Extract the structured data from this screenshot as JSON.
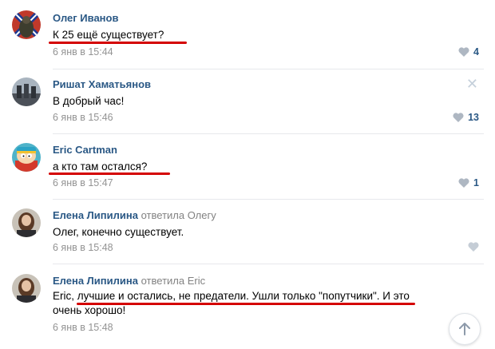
{
  "comments": [
    {
      "author": "Олег Иванов",
      "reply_to": "",
      "text": "К 25 ещё существует?",
      "date": "6 янв в 15:44",
      "likes": "4"
    },
    {
      "author": "Ришат Хаматьянов",
      "reply_to": "",
      "text": "В добрый час!",
      "date": "6 янв в 15:46",
      "likes": "13"
    },
    {
      "author": "Eric Cartman",
      "reply_to": "",
      "text": "а кто там остался?",
      "date": "6 янв в 15:47",
      "likes": "1"
    },
    {
      "author": "Елена Липилина",
      "reply_to": "ответила Олегу",
      "text": "Олег, конечно существует.",
      "date": "6 янв в 15:48",
      "likes": ""
    },
    {
      "author": "Елена Липилина",
      "reply_to": "ответила Eric",
      "text_line1": "Eric, лучшие и остались, не предатели. Ушли только \"попутчики\". И это",
      "text_line2": "очень хорошо!",
      "date": "6 янв в 15:48",
      "likes": ""
    }
  ],
  "colors": {
    "author": "#2a5885",
    "date": "#939393",
    "highlight": "#d40000",
    "divider": "#e7e8ec"
  },
  "icons": {
    "like": "heart-icon",
    "delete": "close-icon",
    "scroll": "arrow-up-icon"
  }
}
